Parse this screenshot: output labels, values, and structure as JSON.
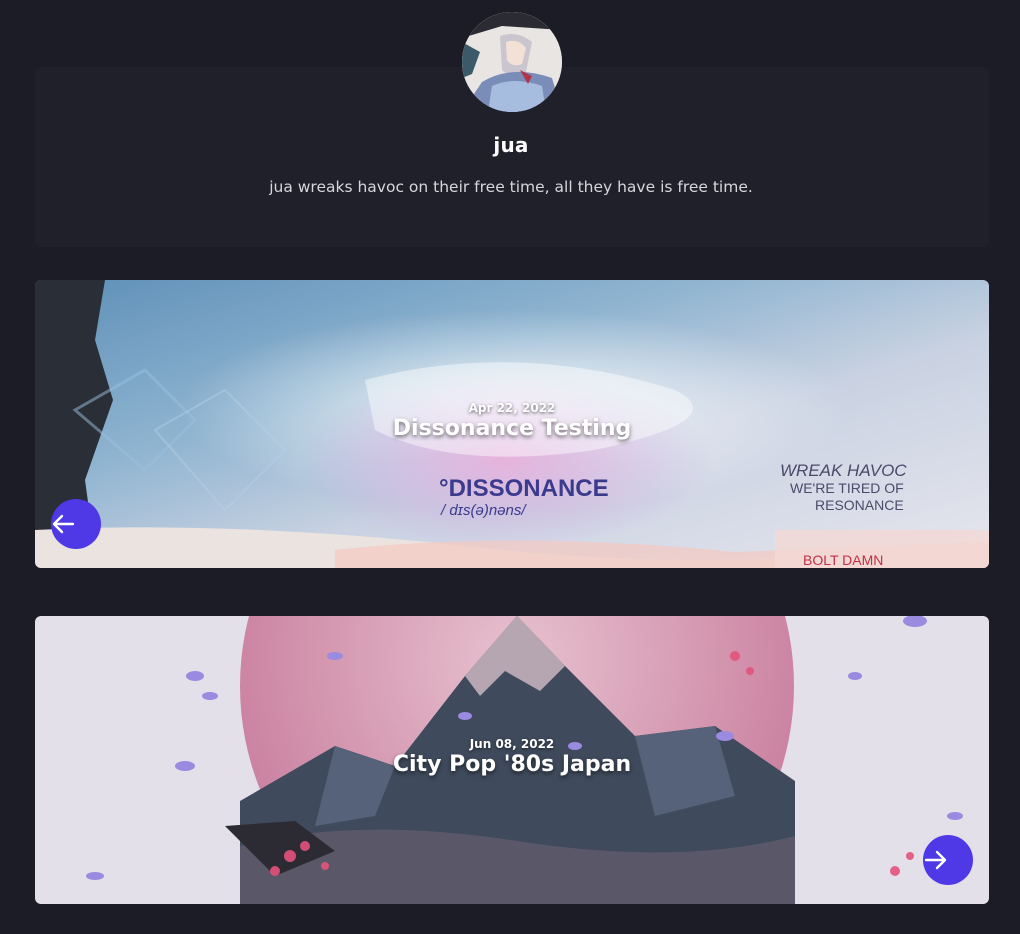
{
  "profile": {
    "username": "jua",
    "bio": "jua wreaks havoc on their free time, all they have is free time."
  },
  "posts": [
    {
      "date": "Apr 22, 2022",
      "title": "Dissonance Testing",
      "artwork_text": {
        "word": "°DISSONANCE",
        "phonetic": "/ dɪs(ə)nəns/",
        "slogan_line1": "WREAK HAVOC",
        "slogan_line2": "WE'RE TIRED OF",
        "slogan_line3": "RESONANCE",
        "footer": "BOLT DAMN"
      }
    },
    {
      "date": "Jun 08, 2022",
      "title": "City Pop '80s Japan"
    }
  ],
  "carousel": {
    "prev_icon": "arrow-left-icon",
    "next_icon": "arrow-right-icon"
  },
  "colors": {
    "background": "#1c1c26",
    "card": "#20202b",
    "accent": "#4f39e6"
  }
}
